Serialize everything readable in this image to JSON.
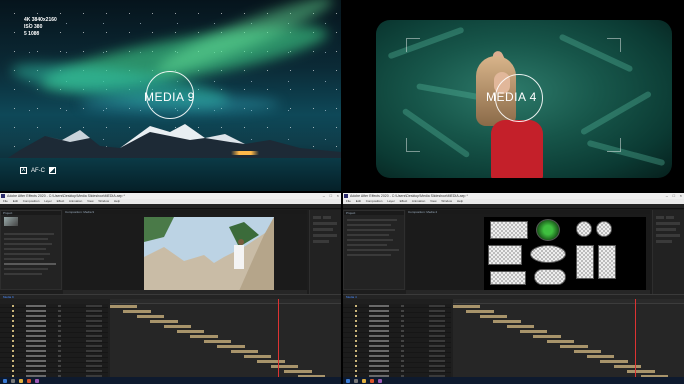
{
  "previews": {
    "left": {
      "label": "MEDIA 9",
      "camera_info": [
        "4K 3840x2160",
        "ISO 380",
        "5 1080"
      ],
      "af_label": "AF-C",
      "af_badge": "X"
    },
    "right": {
      "label": "MEDIA 4"
    }
  },
  "editors": {
    "left": {
      "title": "Adobe After Effects 2020 - C:\\Users\\Desktop\\Media Slideshow\\MEDIA.aep *",
      "menu": [
        "File",
        "Edit",
        "Composition",
        "Layer",
        "Effect",
        "Animation",
        "View",
        "Window",
        "Help"
      ],
      "project_tab": "Project",
      "viewer_tab": "Composition: Media 9",
      "timeline_tab": "Media 9"
    },
    "right": {
      "title": "Adobe After Effects 2020 - C:\\Users\\Desktop\\Media Slideshow\\MEDIA.aep *",
      "menu": [
        "File",
        "Edit",
        "Composition",
        "Layer",
        "Effect",
        "Animation",
        "View",
        "Window",
        "Help"
      ],
      "project_tab": "Project",
      "viewer_tab": "Composition: Media 4",
      "timeline_tab": "Media 4"
    }
  },
  "colors": {
    "aurora": "#46e696",
    "dress": "#c4202a",
    "keyframe_bar": "#bfa878",
    "playhead": "#dd3333"
  }
}
